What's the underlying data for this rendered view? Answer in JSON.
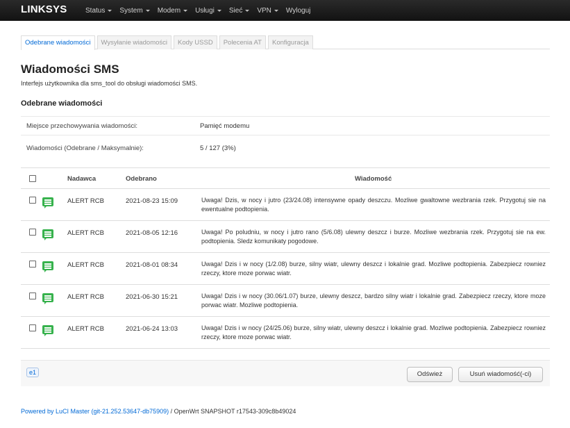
{
  "navbar": {
    "brand": "LINKSYS",
    "menu": [
      {
        "label": "Status",
        "dropdown": true
      },
      {
        "label": "System",
        "dropdown": true
      },
      {
        "label": "Modem",
        "dropdown": true
      },
      {
        "label": "Usługi",
        "dropdown": true
      },
      {
        "label": "Sieć",
        "dropdown": true
      },
      {
        "label": "VPN",
        "dropdown": true
      },
      {
        "label": "Wyloguj",
        "dropdown": false
      }
    ]
  },
  "tabs": [
    {
      "label": "Odebrane wiadomości",
      "active": true
    },
    {
      "label": "Wysyłanie wiadomości",
      "active": false
    },
    {
      "label": "Kody USSD",
      "active": false
    },
    {
      "label": "Polecenia AT",
      "active": false
    },
    {
      "label": "Konfiguracja",
      "active": false
    }
  ],
  "page": {
    "title": "Wiadomości SMS",
    "description": "Interfejs użytkownika dla sms_tool do obsługi wiadomości SMS.",
    "section_title": "Odebrane wiadomości"
  },
  "info": {
    "storage_label": "Miejsce przechowywania wiadomości:",
    "storage_value": "Pamięć modemu",
    "count_label": "Wiadomości (Odebrane / Maksymalnie):",
    "count_value": "5 / 127 (3%)"
  },
  "table": {
    "headers": {
      "sender": "Nadawca",
      "received": "Odebrano",
      "message": "Wiadomość"
    },
    "rows": [
      {
        "sender": "ALERT RCB",
        "date": "2021-08-23 15:09",
        "text": "Uwaga! Dzis, w nocy i jutro (23/24.08) intensywne opady deszczu. Mozliwe gwaltowne wezbrania rzek. Przygotuj sie na ewentualne podtopienia."
      },
      {
        "sender": "ALERT RCB",
        "date": "2021-08-05 12:16",
        "text": "Uwaga! Po poludniu, w nocy i jutro rano (5/6.08) ulewny deszcz i burze. Mozliwe wezbrania rzek. Przygotuj sie na ew. podtopienia. Sledz komunikaty pogodowe."
      },
      {
        "sender": "ALERT RCB",
        "date": "2021-08-01 08:34",
        "text": "Uwaga! Dzis i w nocy (1/2.08) burze, silny wiatr, ulewny deszcz i lokalnie grad. Mozliwe podtopienia. Zabezpiecz rowniez rzeczy, ktore moze porwac wiatr."
      },
      {
        "sender": "ALERT RCB",
        "date": "2021-06-30 15:21",
        "text": "Uwaga! Dzis i w nocy (30.06/1.07) burze, ulewny deszcz, bardzo silny wiatr i lokalnie grad. Zabezpiecz rzeczy, ktore moze porwac wiatr. Mozliwe podtopienia."
      },
      {
        "sender": "ALERT RCB",
        "date": "2021-06-24 13:03",
        "text": "Uwaga! Dzis i w nocy (24/25.06) burze, silny wiatr, ulewny deszcz i lokalnie grad. Mozliwe podtopienia. Zabezpiecz rowniez rzeczy, ktore moze porwac wiatr."
      }
    ]
  },
  "toolbar": {
    "badge": "e1",
    "refresh_label": "Odśwież",
    "delete_label": "Usuń wiadomość(-ci)"
  },
  "footer": {
    "link_text": "Powered by LuCI Master (git-21.252.53647-db75909)",
    "rest_text": " / OpenWrt SNAPSHOT r17543-309c8b49024"
  },
  "colors": {
    "navbar": "#1e1e1e",
    "accent": "#0069d6",
    "message_icon": "#37b24d"
  }
}
